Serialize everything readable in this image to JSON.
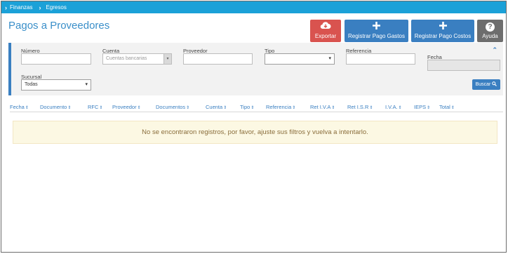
{
  "breadcrumb": {
    "items": [
      "Finanzas",
      "Egresos"
    ]
  },
  "page_title": "Pagos a Proveedores",
  "actions": {
    "export_label": "Exportar",
    "register_expenses_label": "Registrar Pago Gastos",
    "register_costs_label": "Registrar Pago Costos",
    "help_label": "Ayuda"
  },
  "filters": {
    "numero_label": "Número",
    "numero_value": "",
    "cuenta_label": "Cuenta",
    "cuenta_value": "Cuentas bancarias",
    "proveedor_label": "Proveedor",
    "proveedor_value": "",
    "tipo_label": "Tipo",
    "tipo_value": "",
    "referencia_label": "Referencia",
    "referencia_value": "",
    "fecha_label": "Fecha",
    "fecha_value": "",
    "sucursal_label": "Sucursal",
    "sucursal_value": "Todas",
    "search_label": "Buscar"
  },
  "table": {
    "columns": [
      "Fecha",
      "Documento",
      "RFC",
      "Proveedor",
      "Documentos",
      "Cuenta",
      "Tipo",
      "Referencia",
      "Ret I.V.A",
      "Ret I.S.R",
      "I.V.A.",
      "IEPS",
      "Total"
    ]
  },
  "empty_message": "No se encontraron registros, por favor, ajuste sus filtros y vuelva a intentarlo.",
  "colors": {
    "header_bar": "#1ba1d8",
    "primary": "#3a7fc1",
    "export": "#d9534f",
    "help": "#6d6d6d",
    "alert_bg": "#fcf8e3"
  }
}
